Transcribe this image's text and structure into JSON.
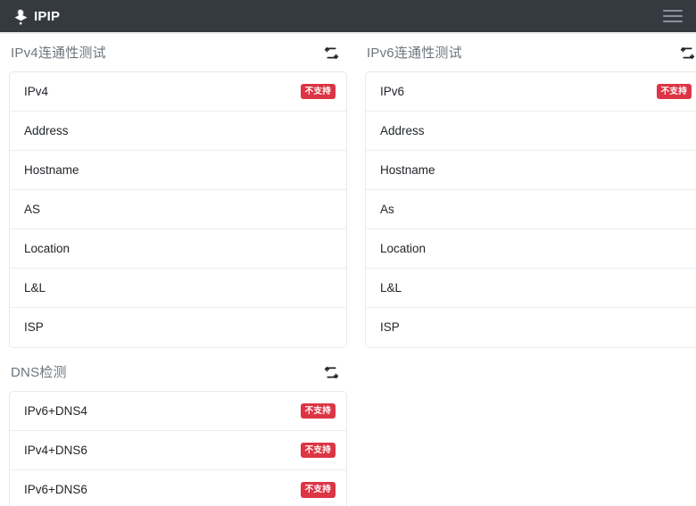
{
  "navbar": {
    "brand_label": "IPIP",
    "brand_icon": "ipip-diamond-logo",
    "menu_icon": "hamburger-menu-icon",
    "background_color": "#343a40"
  },
  "theme": {
    "badge_color": "#dc3545",
    "title_color": "#6c757d",
    "text_color": "#212529",
    "border_color": "#e7e9eb"
  },
  "sections": {
    "ipv4": {
      "title": "IPv4连通性测试",
      "refresh_icon": "repeat-refresh-icon",
      "rows": [
        {
          "label": "IPv4",
          "badge": "不支持"
        },
        {
          "label": "Address",
          "badge": ""
        },
        {
          "label": "Hostname",
          "badge": ""
        },
        {
          "label": "AS",
          "badge": ""
        },
        {
          "label": "Location",
          "badge": ""
        },
        {
          "label": "L&L",
          "badge": ""
        },
        {
          "label": "ISP",
          "badge": ""
        }
      ]
    },
    "ipv6": {
      "title": "IPv6连通性测试",
      "refresh_icon": "repeat-refresh-icon",
      "rows": [
        {
          "label": "IPv6",
          "badge": "不支持"
        },
        {
          "label": "Address",
          "badge": ""
        },
        {
          "label": "Hostname",
          "badge": ""
        },
        {
          "label": "As",
          "badge": ""
        },
        {
          "label": "Location",
          "badge": ""
        },
        {
          "label": "L&L",
          "badge": ""
        },
        {
          "label": "ISP",
          "badge": ""
        }
      ]
    },
    "dns": {
      "title": "DNS检测",
      "refresh_icon": "repeat-refresh-icon",
      "rows": [
        {
          "label": "IPv6+DNS4",
          "badge": "不支持"
        },
        {
          "label": "IPv4+DNS6",
          "badge": "不支持"
        },
        {
          "label": "IPv6+DNS6",
          "badge": "不支持"
        }
      ]
    }
  }
}
